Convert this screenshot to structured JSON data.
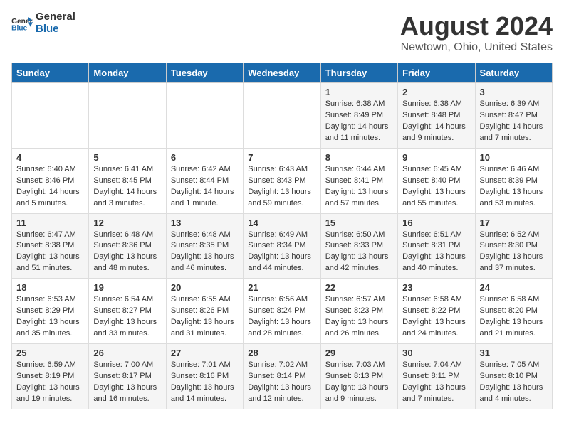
{
  "header": {
    "logo_general": "General",
    "logo_blue": "Blue",
    "title": "August 2024",
    "subtitle": "Newtown, Ohio, United States"
  },
  "days_of_week": [
    "Sunday",
    "Monday",
    "Tuesday",
    "Wednesday",
    "Thursday",
    "Friday",
    "Saturday"
  ],
  "weeks": [
    [
      {
        "day": "",
        "content": ""
      },
      {
        "day": "",
        "content": ""
      },
      {
        "day": "",
        "content": ""
      },
      {
        "day": "",
        "content": ""
      },
      {
        "day": "1",
        "content": "Sunrise: 6:38 AM\nSunset: 8:49 PM\nDaylight: 14 hours and 11 minutes."
      },
      {
        "day": "2",
        "content": "Sunrise: 6:38 AM\nSunset: 8:48 PM\nDaylight: 14 hours and 9 minutes."
      },
      {
        "day": "3",
        "content": "Sunrise: 6:39 AM\nSunset: 8:47 PM\nDaylight: 14 hours and 7 minutes."
      }
    ],
    [
      {
        "day": "4",
        "content": "Sunrise: 6:40 AM\nSunset: 8:46 PM\nDaylight: 14 hours and 5 minutes."
      },
      {
        "day": "5",
        "content": "Sunrise: 6:41 AM\nSunset: 8:45 PM\nDaylight: 14 hours and 3 minutes."
      },
      {
        "day": "6",
        "content": "Sunrise: 6:42 AM\nSunset: 8:44 PM\nDaylight: 14 hours and 1 minute."
      },
      {
        "day": "7",
        "content": "Sunrise: 6:43 AM\nSunset: 8:43 PM\nDaylight: 13 hours and 59 minutes."
      },
      {
        "day": "8",
        "content": "Sunrise: 6:44 AM\nSunset: 8:41 PM\nDaylight: 13 hours and 57 minutes."
      },
      {
        "day": "9",
        "content": "Sunrise: 6:45 AM\nSunset: 8:40 PM\nDaylight: 13 hours and 55 minutes."
      },
      {
        "day": "10",
        "content": "Sunrise: 6:46 AM\nSunset: 8:39 PM\nDaylight: 13 hours and 53 minutes."
      }
    ],
    [
      {
        "day": "11",
        "content": "Sunrise: 6:47 AM\nSunset: 8:38 PM\nDaylight: 13 hours and 51 minutes."
      },
      {
        "day": "12",
        "content": "Sunrise: 6:48 AM\nSunset: 8:36 PM\nDaylight: 13 hours and 48 minutes."
      },
      {
        "day": "13",
        "content": "Sunrise: 6:48 AM\nSunset: 8:35 PM\nDaylight: 13 hours and 46 minutes."
      },
      {
        "day": "14",
        "content": "Sunrise: 6:49 AM\nSunset: 8:34 PM\nDaylight: 13 hours and 44 minutes."
      },
      {
        "day": "15",
        "content": "Sunrise: 6:50 AM\nSunset: 8:33 PM\nDaylight: 13 hours and 42 minutes."
      },
      {
        "day": "16",
        "content": "Sunrise: 6:51 AM\nSunset: 8:31 PM\nDaylight: 13 hours and 40 minutes."
      },
      {
        "day": "17",
        "content": "Sunrise: 6:52 AM\nSunset: 8:30 PM\nDaylight: 13 hours and 37 minutes."
      }
    ],
    [
      {
        "day": "18",
        "content": "Sunrise: 6:53 AM\nSunset: 8:29 PM\nDaylight: 13 hours and 35 minutes."
      },
      {
        "day": "19",
        "content": "Sunrise: 6:54 AM\nSunset: 8:27 PM\nDaylight: 13 hours and 33 minutes."
      },
      {
        "day": "20",
        "content": "Sunrise: 6:55 AM\nSunset: 8:26 PM\nDaylight: 13 hours and 31 minutes."
      },
      {
        "day": "21",
        "content": "Sunrise: 6:56 AM\nSunset: 8:24 PM\nDaylight: 13 hours and 28 minutes."
      },
      {
        "day": "22",
        "content": "Sunrise: 6:57 AM\nSunset: 8:23 PM\nDaylight: 13 hours and 26 minutes."
      },
      {
        "day": "23",
        "content": "Sunrise: 6:58 AM\nSunset: 8:22 PM\nDaylight: 13 hours and 24 minutes."
      },
      {
        "day": "24",
        "content": "Sunrise: 6:58 AM\nSunset: 8:20 PM\nDaylight: 13 hours and 21 minutes."
      }
    ],
    [
      {
        "day": "25",
        "content": "Sunrise: 6:59 AM\nSunset: 8:19 PM\nDaylight: 13 hours and 19 minutes."
      },
      {
        "day": "26",
        "content": "Sunrise: 7:00 AM\nSunset: 8:17 PM\nDaylight: 13 hours and 16 minutes."
      },
      {
        "day": "27",
        "content": "Sunrise: 7:01 AM\nSunset: 8:16 PM\nDaylight: 13 hours and 14 minutes."
      },
      {
        "day": "28",
        "content": "Sunrise: 7:02 AM\nSunset: 8:14 PM\nDaylight: 13 hours and 12 minutes."
      },
      {
        "day": "29",
        "content": "Sunrise: 7:03 AM\nSunset: 8:13 PM\nDaylight: 13 hours and 9 minutes."
      },
      {
        "day": "30",
        "content": "Sunrise: 7:04 AM\nSunset: 8:11 PM\nDaylight: 13 hours and 7 minutes."
      },
      {
        "day": "31",
        "content": "Sunrise: 7:05 AM\nSunset: 8:10 PM\nDaylight: 13 hours and 4 minutes."
      }
    ]
  ]
}
